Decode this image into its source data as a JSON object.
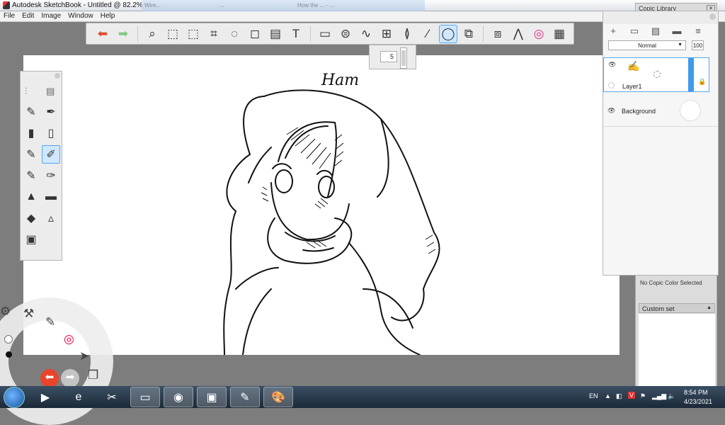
{
  "window": {
    "title": "Autodesk SketchBook - Untitled @ 82.2%",
    "background_tabs": [
      "Wire...",
      "...",
      "How the ... - ..."
    ]
  },
  "menu": [
    "File",
    "Edit",
    "Image",
    "Window",
    "Help"
  ],
  "toolbar": {
    "tools": [
      "undo-icon",
      "redo-icon",
      "zoom-icon",
      "select-icon",
      "transform-select-icon",
      "crop-icon",
      "lasso-icon",
      "distort-icon",
      "fill-icon",
      "text-icon",
      "ruler-icon",
      "ellipse-guide-icon",
      "french-curve-icon",
      "perspective-icon",
      "symmetry-icon",
      "stroke-icon",
      "brush-shape-icon",
      "shapes-icon",
      "layer-editor-icon",
      "brush-library-icon",
      "color-wheel-icon",
      "copic-icon"
    ],
    "glyphs": [
      "⬅",
      "➡",
      "⌕",
      "⬚",
      "⬚",
      "⌗",
      "◌",
      "◻",
      "▤",
      "T",
      "▭",
      "⊜",
      "∿",
      "⊞",
      "≬",
      "⁄",
      "◯",
      "⧉",
      "⧈",
      "⋀",
      "◎",
      "▦"
    ],
    "active_index": 16,
    "brush_size": "5"
  },
  "palette": {
    "tools": [
      "pencil",
      "inking-pen",
      "marker",
      "chisel-marker",
      "paintbrush",
      "airbrush",
      "ballpoint",
      "calligraphy",
      "smudge",
      "eraser",
      "blur",
      "sharpen",
      "fill-brush"
    ],
    "glyphs": [
      "✎",
      "✒",
      "▮",
      "▯",
      "✎",
      "✐",
      "✎",
      "✑",
      "▲",
      "▬",
      "◆",
      "▵",
      "▣"
    ],
    "selected_index": 5
  },
  "layers": {
    "blend_mode": "Normal",
    "opacity": "100",
    "items": [
      {
        "name": "Layer1"
      },
      {
        "name": "Background"
      }
    ]
  },
  "copic": {
    "title": "Copic Library",
    "status": "No Copic Color Selected",
    "set": "Custom set"
  },
  "drawing": {
    "signature": "Ham"
  },
  "lagoon": {
    "glyphs": [
      "⚙",
      "⚒",
      "✎",
      "◎",
      "➤",
      "⬅",
      "➡",
      "❐"
    ]
  },
  "taskbar": {
    "apps": [
      "media-player",
      "internet-explorer",
      "paint",
      "file-explorer",
      "chrome",
      "display",
      "sketchbook",
      "paint-app"
    ],
    "glyphs": [
      "▶",
      "e",
      "✂",
      "▭",
      "◉",
      "▣",
      "✎",
      "🎨"
    ],
    "active_index": 6,
    "lang": "EN",
    "time": "8:54 PM",
    "date": "4/23/2021"
  }
}
